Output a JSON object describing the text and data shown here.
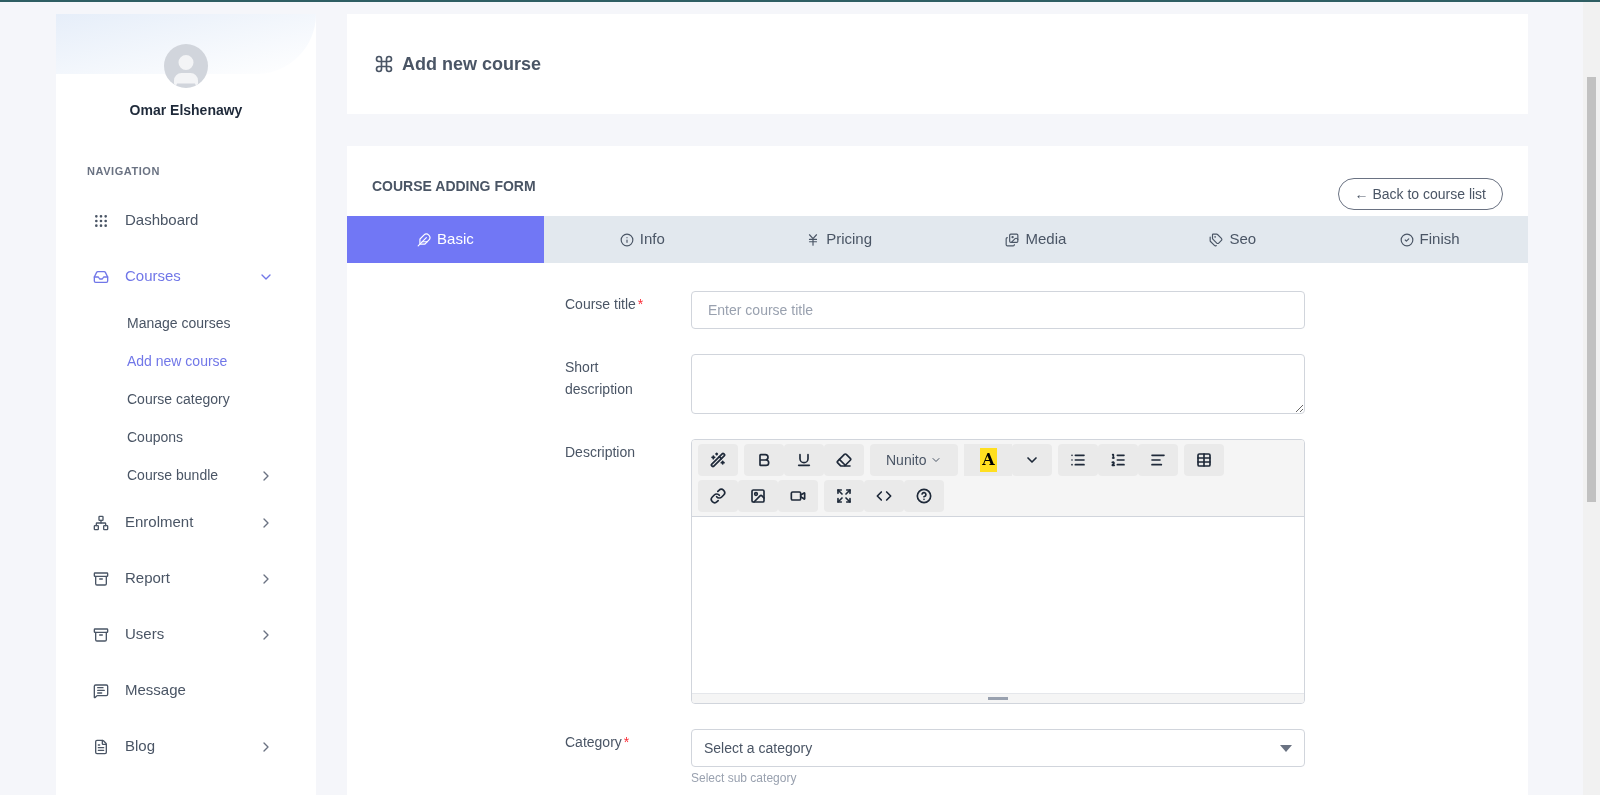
{
  "sidebar": {
    "user_name": "Omar Elshenawy",
    "section_label": "NAVIGATION",
    "items": [
      {
        "label": "Dashboard",
        "selected": false
      },
      {
        "label": "Courses",
        "selected": true,
        "expanded": true,
        "children": [
          {
            "label": "Manage courses",
            "selected": false
          },
          {
            "label": "Add new course",
            "selected": true
          },
          {
            "label": "Course category",
            "selected": false
          },
          {
            "label": "Coupons",
            "selected": false
          },
          {
            "label": "Course bundle",
            "selected": false,
            "expanded": false
          }
        ]
      },
      {
        "label": "Enrolment",
        "selected": false,
        "expanded": false
      },
      {
        "label": "Report",
        "selected": false,
        "expanded": false
      },
      {
        "label": "Users",
        "selected": false,
        "expanded": false
      },
      {
        "label": "Message",
        "selected": false
      },
      {
        "label": "Blog",
        "selected": false,
        "expanded": false
      }
    ]
  },
  "page_title": "Add new course",
  "form": {
    "title": "COURSE ADDING FORM",
    "back_button": "← Back to course list",
    "tabs": [
      {
        "label": "Basic",
        "selected": true
      },
      {
        "label": "Info",
        "selected": false
      },
      {
        "label": "Pricing",
        "selected": false
      },
      {
        "label": "Media",
        "selected": false
      },
      {
        "label": "Seo",
        "selected": false
      },
      {
        "label": "Finish",
        "selected": false
      }
    ],
    "fields": [
      {
        "kind": "input",
        "label": "Course title",
        "required_mark": "*",
        "placeholder": "Enter course title"
      },
      {
        "kind": "textarea",
        "label": "Short description"
      },
      {
        "kind": "editor",
        "label": "Description",
        "font": "Nunito",
        "highlight_label": "A"
      },
      {
        "kind": "select",
        "label": "Category",
        "required_mark": "*",
        "value": "Select a category",
        "hint": "Select sub category"
      }
    ]
  }
}
